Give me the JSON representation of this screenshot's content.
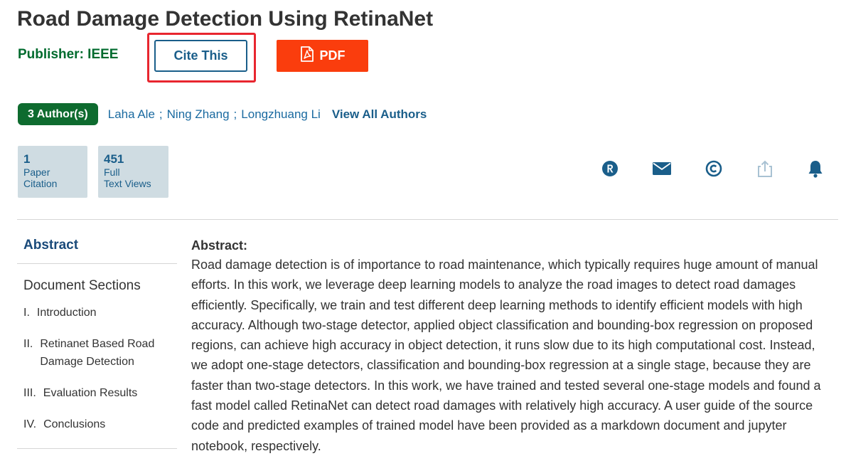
{
  "title": "Road Damage Detection Using RetinaNet",
  "publisher": "Publisher: IEEE",
  "buttons": {
    "cite": "Cite This",
    "pdf": "PDF"
  },
  "authors": {
    "badge": "3 Author(s)",
    "names": [
      "Laha Ale",
      "Ning Zhang",
      "Longzhuang Li"
    ],
    "separator": ";",
    "view_all": "View All Authors"
  },
  "metrics": [
    {
      "value": "1",
      "label_line1": "Paper",
      "label_line2": "Citation"
    },
    {
      "value": "451",
      "label_line1": "Full",
      "label_line2": "Text Views"
    }
  ],
  "action_icons": [
    "rights-icon",
    "email-icon",
    "copyright-icon",
    "share-icon",
    "alert-bell-icon"
  ],
  "colors": {
    "publisher_green": "#006b2e",
    "badge_green": "#0e6b2f",
    "link_blue": "#1a6aa0",
    "pdf_orange": "#fa3d0d",
    "highlight_red": "#e8262f",
    "metric_bg": "#cfdce2"
  },
  "sidebar": {
    "abstract_link": "Abstract",
    "sections_heading": "Document Sections",
    "sections": [
      {
        "num": "I.",
        "label": "Introduction"
      },
      {
        "num": "II.",
        "label": "Retinanet Based Road Damage Detection"
      },
      {
        "num": "III.",
        "label": "Evaluation Results"
      },
      {
        "num": "IV.",
        "label": "Conclusions"
      }
    ]
  },
  "abstract": {
    "label": "Abstract:",
    "text": "Road damage detection is of importance to road maintenance, which typically requires huge amount of manual efforts. In this work, we leverage deep learning models to analyze the road images to detect road damages efficiently. Specifically, we train and test different deep learning methods to identify efficient models with high accuracy. Although two-stage detector, applied object classification and bounding-box regression on proposed regions, can achieve high accuracy in object detection, it runs slow due to its high computational cost. Instead, we adopt one-stage detectors, classification and bounding-box regression at a single stage, because they are faster than two-stage detectors. In this work, we have trained and tested several one-stage models and found a fast model called RetinaNet can detect road damages with relatively high accuracy. A user guide of the source code and predicted examples of trained model have been provided as a markdown document and jupyter notebook, respectively."
  }
}
